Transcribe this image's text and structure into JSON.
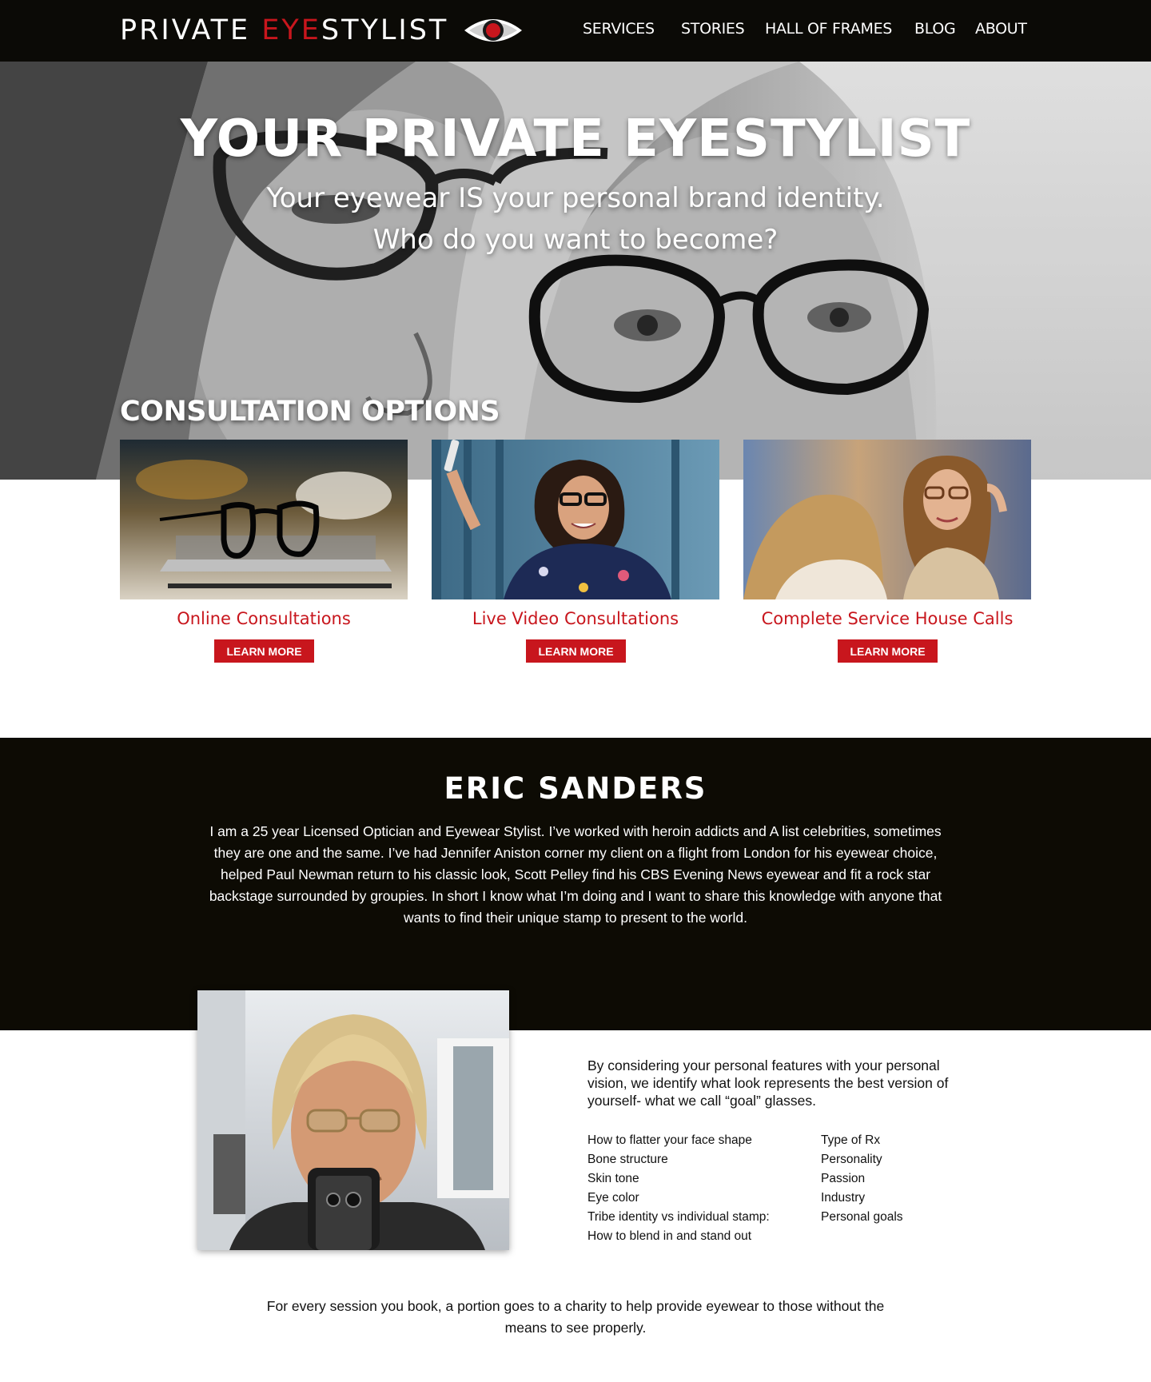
{
  "brand": {
    "name_first": "PRIVATE ",
    "name_accent": "EYE",
    "name_last": "STYLIST",
    "accent_color": "#c8161d",
    "icon": "eye-icon"
  },
  "nav": {
    "items": [
      {
        "label": "SERVICES"
      },
      {
        "label": "STORIES"
      },
      {
        "label": "HALL OF FRAMES"
      },
      {
        "label": "BLOG"
      },
      {
        "label": "ABOUT"
      }
    ]
  },
  "hero": {
    "title": "YOUR PRIVATE EYESTYLIST",
    "subtitle_line1": "Your eyewear IS your personal brand identity.",
    "subtitle_line2": "Who do you want to become?"
  },
  "consultations": {
    "heading": "CONSULTATION OPTIONS",
    "cards": [
      {
        "title": "Online Consultations",
        "button": "LEARN MORE"
      },
      {
        "title": "Live Video Consultations",
        "button": "LEARN MORE"
      },
      {
        "title": "Complete Service House Calls",
        "button": "LEARN MORE"
      }
    ]
  },
  "bio": {
    "name": "ERIC SANDERS",
    "text": "I am a 25 year Licensed Optician and Eyewear Stylist.  I’ve worked with heroin addicts and A list celebrities, sometimes they are one and the same. I’ve had Jennifer Aniston corner my client on a flight from London for his eyewear choice, helped Paul Newman return to his classic look, Scott Pelley find his CBS Evening News eyewear and fit a rock star backstage surrounded by groupies. In short I know what I’m doing and I want to share this knowledge with anyone that wants to find their unique stamp to present to the world."
  },
  "process": {
    "intro": "By considering your personal features with your personal vision, we identify what look represents the best version of yourself- what we call “goal” glasses.",
    "features_left": [
      "How to flatter your face shape",
      "Bone structure",
      "Skin tone",
      "Eye color",
      "Tribe identity vs individual stamp:",
      "How to blend in and stand out"
    ],
    "features_right": [
      "Type of Rx",
      "Personality",
      "Passion",
      "Industry",
      "Personal goals"
    ]
  },
  "charity": {
    "text": "For every session you book, a portion goes to a charity to help provide eyewear to those without the means to see properly."
  }
}
